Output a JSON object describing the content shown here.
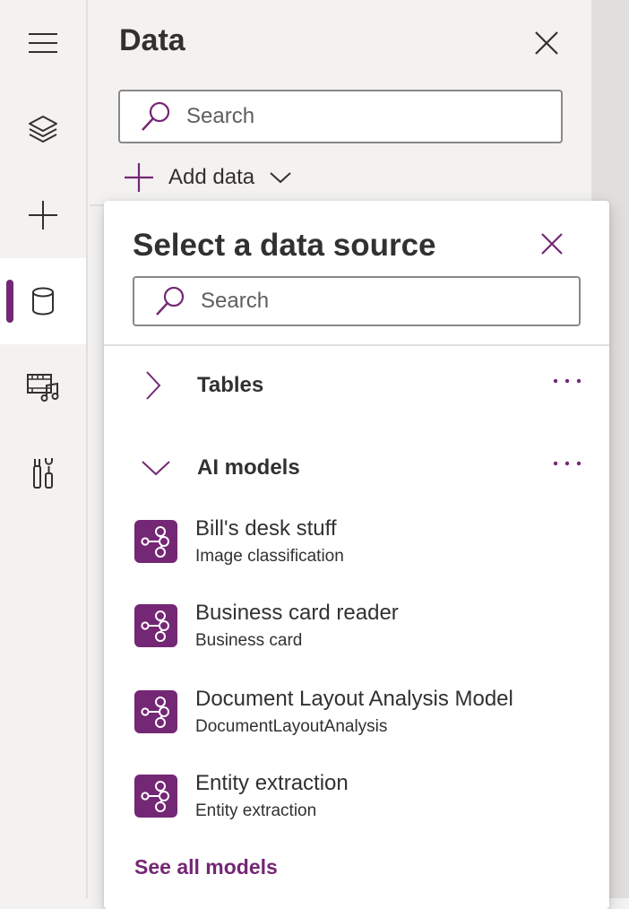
{
  "rail": {
    "items": [
      {
        "icon": "hamburger-icon"
      },
      {
        "icon": "layers-icon"
      },
      {
        "icon": "plus-icon"
      },
      {
        "icon": "database-icon",
        "active": true
      },
      {
        "icon": "media-icon"
      },
      {
        "icon": "tools-icon"
      }
    ]
  },
  "pane": {
    "title": "Data",
    "search_placeholder": "Search",
    "add_data_label": "Add data"
  },
  "flyout": {
    "title": "Select a data source",
    "search_placeholder": "Search",
    "groups": [
      {
        "label": "Tables",
        "expanded": false
      },
      {
        "label": "AI models",
        "expanded": true
      }
    ],
    "models": [
      {
        "name": "Bill's desk stuff",
        "type": "Image classification"
      },
      {
        "name": "Business card reader",
        "type": "Business card"
      },
      {
        "name": "Document Layout Analysis Model",
        "type": "DocumentLayoutAnalysis"
      },
      {
        "name": "Entity extraction",
        "type": "Entity extraction"
      }
    ],
    "see_all_label": "See all models"
  },
  "colors": {
    "accent": "#742774",
    "pane_bg": "#f3f2f1",
    "text": "#323130"
  }
}
